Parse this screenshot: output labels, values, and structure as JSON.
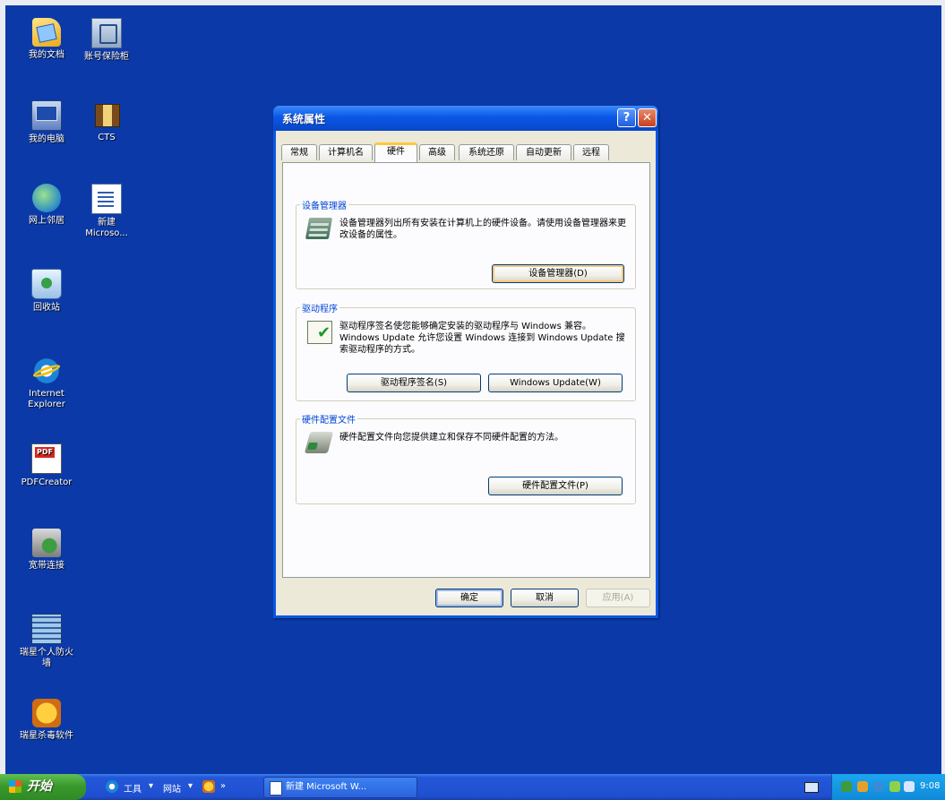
{
  "desktop": {
    "icons": [
      {
        "label": "我的文档",
        "icon": "my-documents-icon"
      },
      {
        "label": "账号保险柜",
        "icon": "account-safe-icon"
      },
      {
        "label": "我的电脑",
        "icon": "my-computer-icon"
      },
      {
        "label": "CTS",
        "icon": "cts-icon"
      },
      {
        "label": "网上邻居",
        "icon": "network-places-icon"
      },
      {
        "label": "新建\nMicroso...",
        "icon": "new-document-icon"
      },
      {
        "label": "回收站",
        "icon": "recycle-bin-icon"
      },
      {
        "label": "Internet\nExplorer",
        "icon": "internet-explorer-icon"
      },
      {
        "label": "PDFCreator",
        "icon": "pdf-creator-icon"
      },
      {
        "label": "宽带连接",
        "icon": "broadband-connection-icon"
      },
      {
        "label": "瑞星个人防火\n墙",
        "icon": "firewall-icon"
      },
      {
        "label": "瑞星杀毒软件",
        "icon": "antivirus-icon"
      }
    ]
  },
  "window": {
    "title": "系统属性",
    "help_glyph": "?",
    "close_glyph": "✕",
    "tabs": [
      "常规",
      "计算机名",
      "硬件",
      "高级",
      "系统还原",
      "自动更新",
      "远程"
    ],
    "active_tab": "硬件",
    "groups": {
      "device_manager": {
        "title": "设备管理器",
        "text": "设备管理器列出所有安装在计算机上的硬件设备。请使用设备管理器来更改设备的属性。",
        "button": "设备管理器(D)"
      },
      "drivers": {
        "title": "驱动程序",
        "text": "驱动程序签名使您能够确定安装的驱动程序与 Windows 兼容。Windows Update 允许您设置 Windows 连接到 Windows Update 搜索驱动程序的方式。",
        "button_signing": "驱动程序签名(S)",
        "button_update": "Windows Update(W)"
      },
      "hardware_profiles": {
        "title": "硬件配置文件",
        "text": "硬件配置文件向您提供建立和保存不同硬件配置的方法。",
        "button": "硬件配置文件(P)"
      }
    },
    "footer": {
      "ok": "确定",
      "cancel": "取消",
      "apply": "应用(A)"
    }
  },
  "taskbar": {
    "start_label": "开始",
    "toolbar_tools": "工具",
    "toolbar_sites": "网站",
    "task_button": "新建 Microsoft W...",
    "clock": "9:08"
  },
  "colors": {
    "desktop_bg": "#0b3aa8",
    "title_blue": "#0a57e5",
    "dialog_bg": "#ece9d8",
    "group_title": "#0046d5",
    "start_green": "#3a9a2e",
    "tray_blue": "#1da5f0"
  }
}
